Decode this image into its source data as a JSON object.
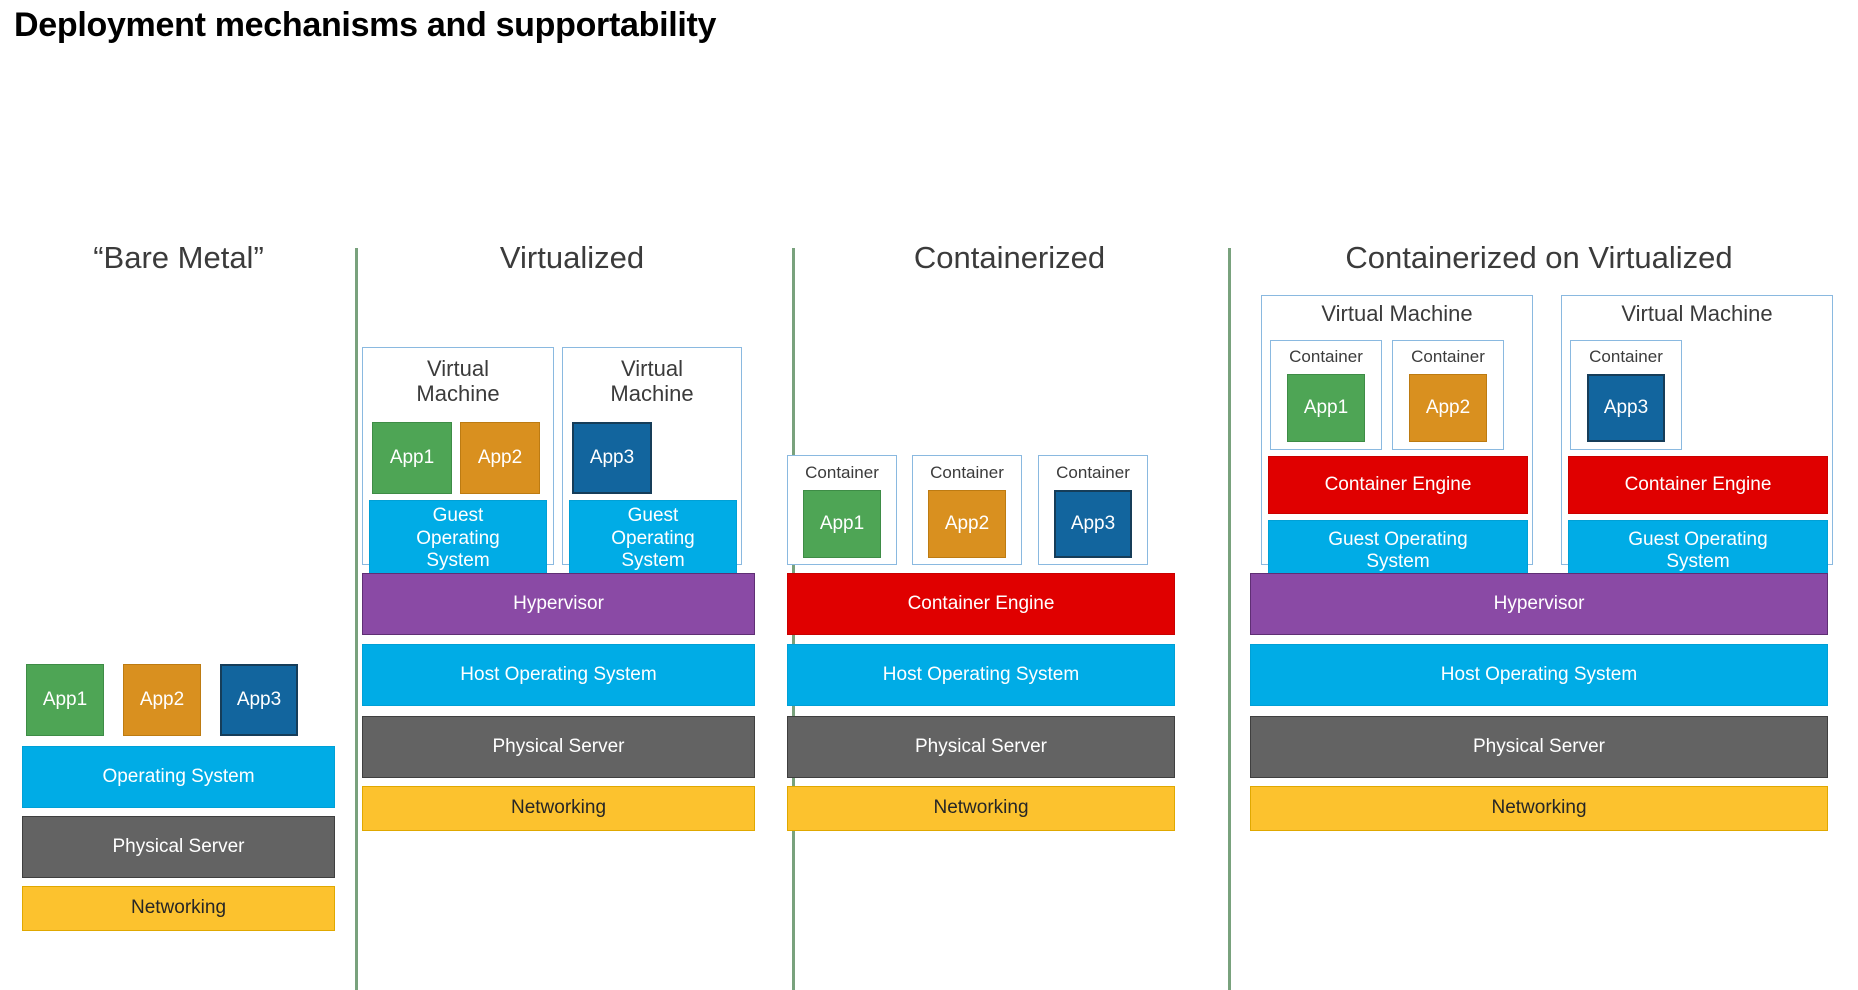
{
  "title": "Deployment mechanisms and supportability",
  "labels": {
    "virtual_machine": "Virtual Machine",
    "virtual_machine_l1": "Virtual",
    "virtual_machine_l2": "Machine",
    "container": "Container",
    "app1": "App1",
    "app2": "App2",
    "app3": "App3",
    "operating_system": "Operating System",
    "host_operating_system": "Host Operating System",
    "guest_operating_system": "Guest Operating System",
    "guest_os_l1": "Guest",
    "guest_os_l2": "Operating",
    "guest_os_l3": "System",
    "guest_os_two_l1": "Guest Operating",
    "guest_os_two_l2": "System",
    "physical_server": "Physical Server",
    "networking": "Networking",
    "hypervisor": "Hypervisor",
    "container_engine": "Container Engine"
  },
  "columns": [
    {
      "id": "bare-metal",
      "header": "“Bare Metal”",
      "stack": [
        "Operating System",
        "Physical Server",
        "Networking"
      ],
      "apps": [
        "App1",
        "App2",
        "App3"
      ]
    },
    {
      "id": "virtualized",
      "header": "Virtualized",
      "stack": [
        "Hypervisor",
        "Host Operating System",
        "Physical Server",
        "Networking"
      ],
      "virtual_machines": [
        {
          "label": "Virtual Machine",
          "apps": [
            "App1",
            "App2"
          ],
          "guest_os": "Guest Operating System"
        },
        {
          "label": "Virtual Machine",
          "apps": [
            "App3"
          ],
          "guest_os": "Guest Operating System"
        }
      ]
    },
    {
      "id": "containerized",
      "header": "Containerized",
      "stack": [
        "Container Engine",
        "Host Operating System",
        "Physical Server",
        "Networking"
      ],
      "containers": [
        {
          "label": "Container",
          "app": "App1"
        },
        {
          "label": "Container",
          "app": "App2"
        },
        {
          "label": "Container",
          "app": "App3"
        }
      ]
    },
    {
      "id": "containerized-on-virtualized",
      "header": "Containerized on Virtualized",
      "stack": [
        "Hypervisor",
        "Host Operating System",
        "Physical Server",
        "Networking"
      ],
      "virtual_machines": [
        {
          "label": "Virtual Machine",
          "containers": [
            {
              "label": "Container",
              "app": "App1"
            },
            {
              "label": "Container",
              "app": "App2"
            }
          ],
          "container_engine": "Container Engine",
          "guest_os": "Guest Operating System"
        },
        {
          "label": "Virtual Machine",
          "containers": [
            {
              "label": "Container",
              "app": "App3"
            }
          ],
          "container_engine": "Container Engine",
          "guest_os": "Guest Operating System"
        }
      ]
    }
  ],
  "colors": {
    "app1_green": "#4ea555",
    "app2_orange": "#d9901f",
    "app3_blue": "#12659e",
    "os_blue": "#00ace6",
    "server_gray": "#636363",
    "networking_yellow": "#fcc22e",
    "hypervisor_purple": "#8a4aa5",
    "engine_red": "#e00000",
    "divider_green": "#79a27d",
    "outline_blue": "#8ab9e0"
  }
}
